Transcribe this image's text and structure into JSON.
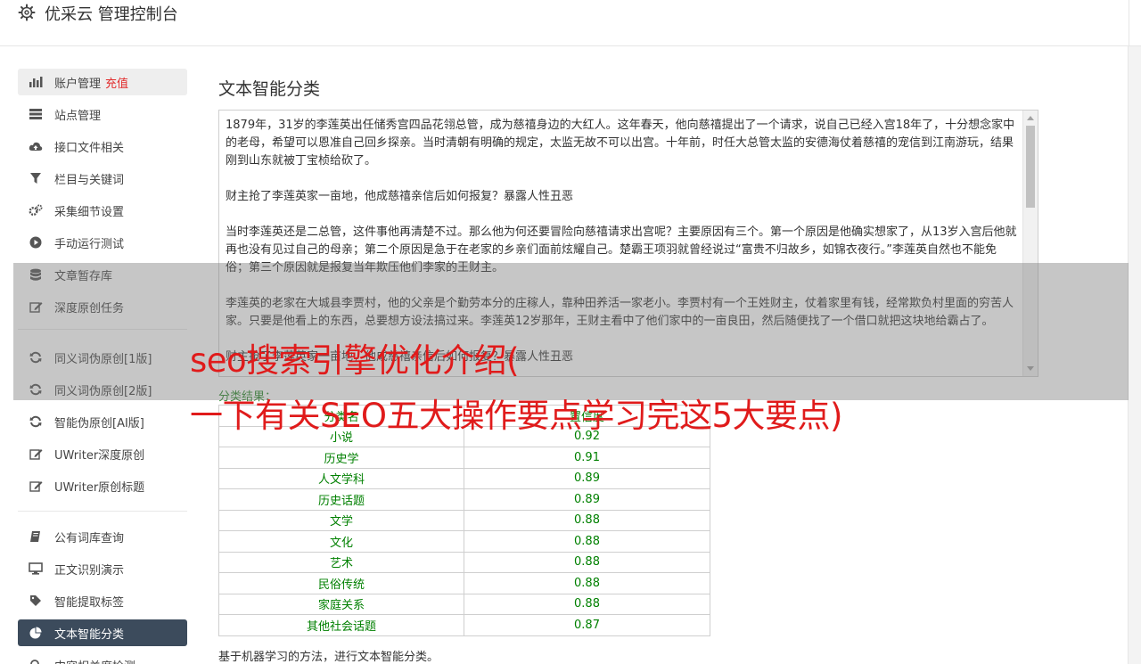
{
  "app": {
    "title": "优采云 管理控制台"
  },
  "sidebar": {
    "items": [
      {
        "label": "账户管理",
        "badge": "充值",
        "icon": "bar-chart-icon"
      },
      {
        "label": "站点管理",
        "icon": "server-icon"
      },
      {
        "label": "接口文件相关",
        "icon": "cloud-upload-icon"
      },
      {
        "label": "栏目与关键词",
        "icon": "filter-icon"
      },
      {
        "label": "采集细节设置",
        "icon": "cogs-icon"
      },
      {
        "label": "手动运行测试",
        "icon": "play-icon"
      },
      {
        "label": "文章暂存库",
        "icon": "database-icon"
      },
      {
        "label": "深度原创任务",
        "icon": "edit-icon"
      },
      {
        "label": "同义词伪原创[1版]",
        "icon": "refresh-icon"
      },
      {
        "label": "同义词伪原创[2版]",
        "icon": "refresh-icon"
      },
      {
        "label": "智能伪原创[AI版]",
        "icon": "refresh-icon"
      },
      {
        "label": "UWriter深度原创",
        "icon": "edit-icon"
      },
      {
        "label": "UWriter原创标题",
        "icon": "edit-icon"
      },
      {
        "label": "公有词库查询",
        "icon": "book-icon"
      },
      {
        "label": "正文识别演示",
        "icon": "desktop-icon"
      },
      {
        "label": "智能提取标签",
        "icon": "tag-icon"
      },
      {
        "label": "文本智能分类",
        "icon": "pie-chart-icon"
      },
      {
        "label": "内容相关度检测",
        "icon": "search-icon"
      }
    ]
  },
  "main": {
    "title": "文本智能分类",
    "text": "1879年，31岁的李莲英出任储秀宫四品花翎总管，成为慈禧身边的大红人。这年春天，他向慈禧提出了一个请求，说自己已经入宫18年了，十分想念家中的老母，希望可以恩准自己回乡探亲。当时清朝有明确的规定，太监无故不可以出宫。十年前，时任大总管太监的安德海仗着慈禧的宠信到江南游玩，结果刚到山东就被丁宝桢给砍了。\n\n财主抢了李莲英家一亩地，他成慈禧亲信后如何报复？暴露人性丑恶\n\n当时李莲英还是二总管，这件事他再清楚不过。那么他为何还要冒险向慈禧请求出宫呢？主要原因有三个。第一个原因是他确实想家了，从13岁入宫后他就再也没有见过自己的母亲；第二个原因是急于在老家的乡亲们面前炫耀自己。楚霸王项羽就曾经说过“富贵不归故乡，如锦衣夜行。”李莲英自然也不能免俗；第三个原因就是报复当年欺压他们李家的王财主。\n\n李莲英的老家在大城县李贾村，他的父亲是个勤劳本分的庄稼人，靠种田养活一家老小。李贾村有一个王姓财主，仗着家里有钱，经常欺负村里面的穷苦人家。只要是他看上的东西，总要想方设法搞过来。李莲英12岁那年，王财主看中了他们家中的一亩良田，然后随便找了一个借口就把这块地给霸占了。\n\n财主抢了李莲英家一亩地，他成慈禧亲信后如何报复？暴露人性丑恶",
    "result_label": "分类结果：",
    "table": {
      "headers": [
        "分类名",
        "置信度"
      ],
      "rows": [
        [
          "小说",
          "0.92"
        ],
        [
          "历史学",
          "0.91"
        ],
        [
          "人文学科",
          "0.89"
        ],
        [
          "历史话题",
          "0.89"
        ],
        [
          "文学",
          "0.88"
        ],
        [
          "文化",
          "0.88"
        ],
        [
          "艺术",
          "0.88"
        ],
        [
          "民俗传统",
          "0.88"
        ],
        [
          "家庭关系",
          "0.88"
        ],
        [
          "其他社会话题",
          "0.87"
        ]
      ]
    },
    "description": "基于机器学习的方法，进行文本智能分类。"
  },
  "overlay": {
    "line1": "seo搜索引擎优化介绍(",
    "line2": "一下有关SEO五大操作要点学习完这5大要点)"
  },
  "colors": {
    "active_bg": "#3c4b5c",
    "badge": "#e22b2b",
    "result_green": "#008000",
    "headline": "#e01b1b"
  }
}
